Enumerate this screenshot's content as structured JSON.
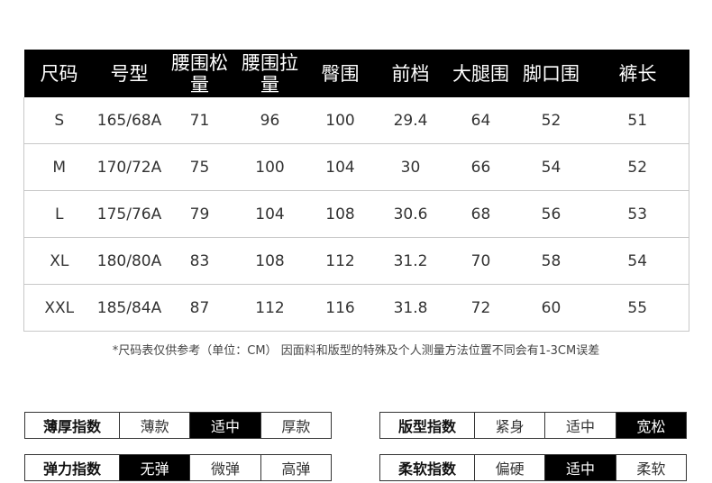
{
  "table": {
    "headers": [
      {
        "text": "尺码",
        "name": "size"
      },
      {
        "text": "号型",
        "name": "model"
      },
      {
        "text": "腰围松量",
        "name": "waist-relaxed"
      },
      {
        "text": "腰围拉量",
        "name": "waist-stretched"
      },
      {
        "text": "臀围",
        "name": "hip"
      },
      {
        "text": "前档",
        "name": "front-rise"
      },
      {
        "text": "大腿围",
        "name": "thigh"
      },
      {
        "text": "脚口围",
        "name": "leg-opening"
      },
      {
        "text": "裤长",
        "name": "length"
      }
    ],
    "rows": [
      [
        "S",
        "165/68A",
        "71",
        "96",
        "100",
        "29.4",
        "64",
        "52",
        "51"
      ],
      [
        "M",
        "170/72A",
        "75",
        "100",
        "104",
        "30",
        "66",
        "54",
        "52"
      ],
      [
        "L",
        "175/76A",
        "79",
        "104",
        "108",
        "30.6",
        "68",
        "56",
        "53"
      ],
      [
        "XL",
        "180/80A",
        "83",
        "108",
        "112",
        "31.2",
        "70",
        "58",
        "54"
      ],
      [
        "XXL",
        "185/84A",
        "87",
        "112",
        "116",
        "31.8",
        "72",
        "60",
        "55"
      ]
    ]
  },
  "note": "*尺码表仅供参考（单位：CM） 因面料和版型的特殊及个人测量方法位置不同会有1-3CM误差",
  "indices": {
    "thickness": {
      "label": "薄厚指数",
      "options": [
        "薄款",
        "适中",
        "厚款"
      ],
      "selected": 1
    },
    "fit": {
      "label": "版型指数",
      "options": [
        "紧身",
        "适中",
        "宽松"
      ],
      "selected": 2
    },
    "elasticity": {
      "label": "弹力指数",
      "options": [
        "无弹",
        "微弹",
        "高弹"
      ],
      "selected": 0
    },
    "softness": {
      "label": "柔软指数",
      "options": [
        "偏硬",
        "适中",
        "柔软"
      ],
      "selected": 1
    }
  }
}
